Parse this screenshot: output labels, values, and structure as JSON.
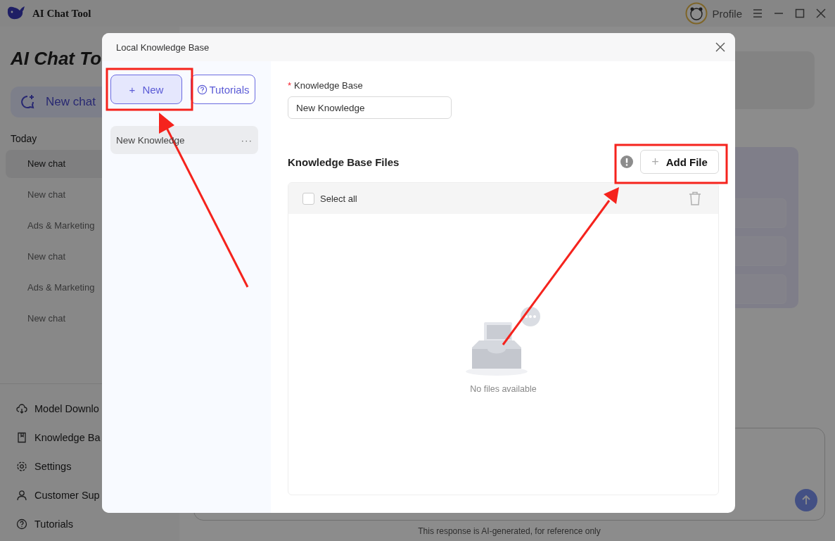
{
  "app": {
    "title": "AI Chat Tool",
    "profile": "Profile"
  },
  "sidebar": {
    "heading": "AI Chat To",
    "new_chat": "New chat",
    "section": "Today",
    "chats": [
      {
        "label": "New chat",
        "selected": true
      },
      {
        "label": "New chat",
        "selected": false
      },
      {
        "label": "Ads & Marketing",
        "selected": false
      },
      {
        "label": "New chat",
        "selected": false
      },
      {
        "label": "Ads & Marketing",
        "selected": false
      },
      {
        "label": "New chat",
        "selected": false
      }
    ],
    "menu": [
      "Model Downlo",
      "Knowledge Ba",
      "Settings",
      "Customer Sup",
      "Tutorials"
    ]
  },
  "footer_note": "This response is AI-generated, for reference only",
  "dialog": {
    "title": "Local Knowledge Base",
    "new_button": {
      "icon": "+",
      "label": "New"
    },
    "tutorials_button": "Tutorials",
    "knowledge_list": [
      {
        "name": "New Knowledge",
        "more": "···",
        "selected": true
      }
    ],
    "form": {
      "label": "Knowledge Base",
      "required_mark": "*",
      "value": "New Knowledge"
    },
    "files": {
      "heading": "Knowledge Base Files",
      "add_button": "Add File",
      "select_all": {
        "label": "Select all",
        "checked": false
      },
      "empty_text": "No files available"
    }
  }
}
